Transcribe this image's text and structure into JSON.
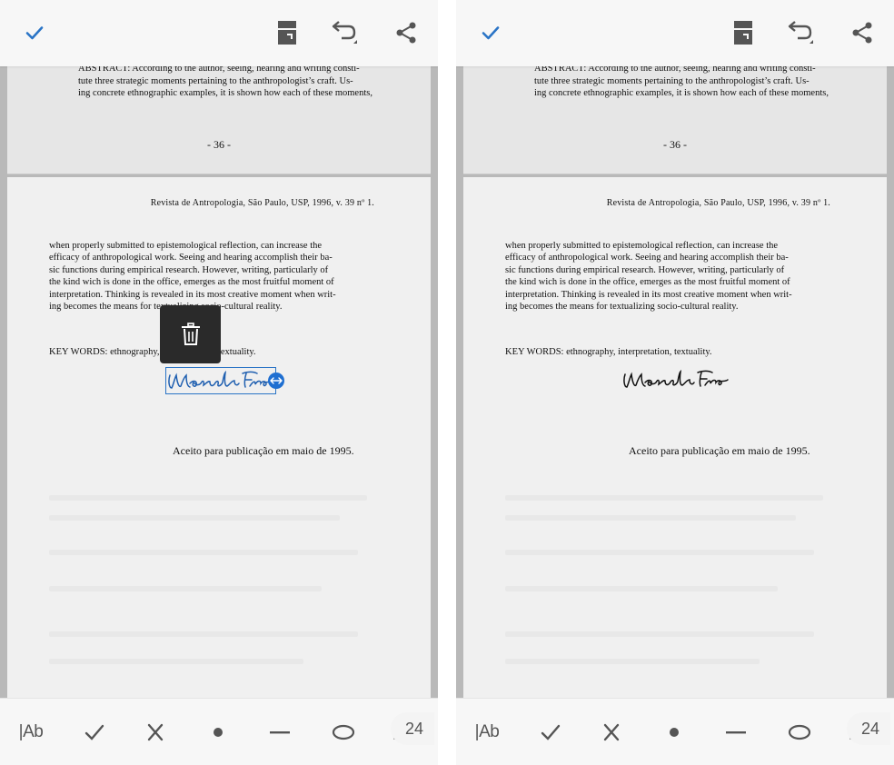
{
  "document": {
    "abstract": "ABSTRACT: According to the author, seeing, hearing and writing consti-\ntute three strategic moments pertaining to the anthropologist’s craft. Us-\ning concrete ethnographic examples, it is shown how each of these moments,",
    "prev_page_number": "- 36 -",
    "running_head": "Revista de Antropologia, São Paulo, USP, 1996, v. 39 nº 1.",
    "body": "when properly submitted to epistemological reflection, can increase the\nefficacy of anthropological work. Seeing and hearing accomplish their ba-\nsic functions during empirical research. However, writing, particularly of\nthe kind wich is done in the office, emerges as the most fruitful moment of\ninterpretation. Thinking is revealed in its most creative moment when writ-\ning becomes the means for textualizing socio-cultural reality.",
    "keywords": "KEY WORDS: ethnography, interpretation, textuality.",
    "accepted": "Aceito para publicação em maio de 1995."
  },
  "page_badge": "24",
  "left_panel": {
    "signature_state": "selected",
    "popup": {
      "icon": "trash-icon"
    }
  },
  "right_panel": {
    "signature_state": "placed"
  },
  "toolbar": {
    "text_tool_label": "|Ab",
    "tools": [
      "text-tool",
      "checkmark-tool",
      "cross-tool",
      "dot-tool",
      "line-tool",
      "ellipse-tool",
      "signature-tool"
    ]
  },
  "header": {
    "icons": [
      "check-icon",
      "layout-icon",
      "undo-icon",
      "share-icon"
    ]
  },
  "colors": {
    "accent": "#2a74c6",
    "signature_selected": "#1f5fb0",
    "signature_placed": "#111111",
    "icon": "#555555"
  }
}
